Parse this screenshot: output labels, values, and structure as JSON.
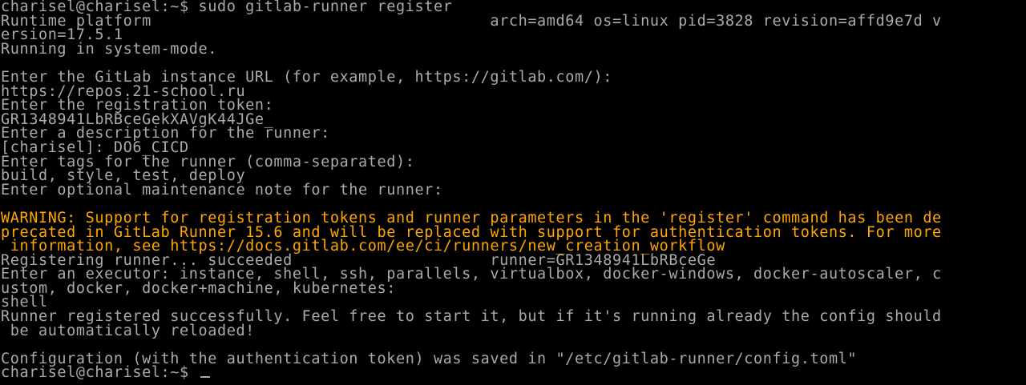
{
  "terminal": {
    "colors": {
      "background": "#000000",
      "text": "#aaaaaa",
      "warning": "#ffa500"
    },
    "lines": [
      {
        "text": "charisel@charisel:~$ sudo gitlab-runner register",
        "warn": false
      },
      {
        "text": "Runtime platform                                    arch=amd64 os=linux pid=3828 revision=affd9e7d v",
        "warn": false
      },
      {
        "text": "ersion=17.5.1",
        "warn": false
      },
      {
        "text": "Running in system-mode.",
        "warn": false
      },
      {
        "text": "",
        "warn": false
      },
      {
        "text": "Enter the GitLab instance URL (for example, https://gitlab.com/):",
        "warn": false
      },
      {
        "text": "https://repos.21-school.ru",
        "warn": false
      },
      {
        "text": "Enter the registration token:",
        "warn": false
      },
      {
        "text": "GR1348941LbRBceGekXAVgK44JGe_",
        "warn": false
      },
      {
        "text": "Enter a description for the runner:",
        "warn": false
      },
      {
        "text": "[charisel]: DO6_CICD",
        "warn": false
      },
      {
        "text": "Enter tags for the runner (comma-separated):",
        "warn": false
      },
      {
        "text": "build, style, test, deploy",
        "warn": false
      },
      {
        "text": "Enter optional maintenance note for the runner:",
        "warn": false
      },
      {
        "text": "",
        "warn": false
      },
      {
        "text": "WARNING: Support for registration tokens and runner parameters in the 'register' command has been de",
        "warn": true
      },
      {
        "text": "precated in GitLab Runner 15.6 and will be replaced with support for authentication tokens. For more",
        "warn": true
      },
      {
        "text": " information, see https://docs.gitlab.com/ee/ci/runners/new_creation_workflow",
        "warn": true
      },
      {
        "text": "Registering runner... succeeded                     runner=GR1348941LbRBceGe",
        "warn": false
      },
      {
        "text": "Enter an executor: instance, shell, ssh, parallels, virtualbox, docker-windows, docker-autoscaler, c",
        "warn": false
      },
      {
        "text": "ustom, docker, docker+machine, kubernetes:",
        "warn": false
      },
      {
        "text": "shell",
        "warn": false
      },
      {
        "text": "Runner registered successfully. Feel free to start it, but if it's running already the config should",
        "warn": false
      },
      {
        "text": " be automatically reloaded!",
        "warn": false
      },
      {
        "text": "",
        "warn": false
      },
      {
        "text": "Configuration (with the authentication token) was saved in \"/etc/gitlab-runner/config.toml\"",
        "warn": false
      }
    ],
    "prompt": "charisel@charisel:~$ "
  }
}
